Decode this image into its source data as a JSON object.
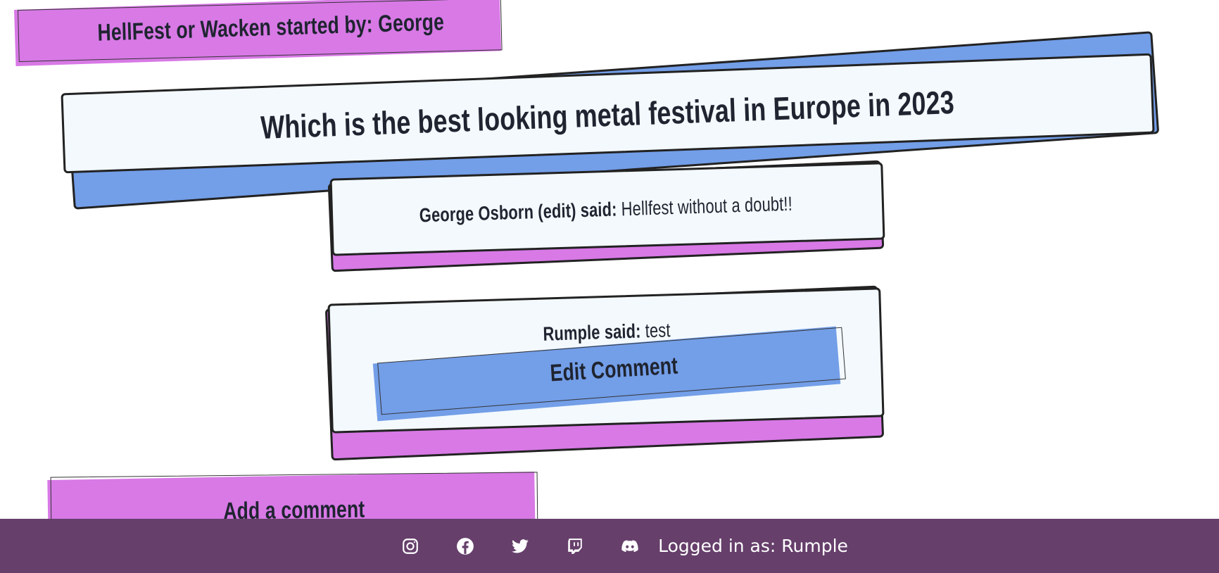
{
  "thread": {
    "started_by_label": "HellFest or Wacken started by: George",
    "title": "Which is the best looking metal festival in Europe in 2023"
  },
  "comments": [
    {
      "author": "George Osborn (edit) said:",
      "body": "Hellfest without a doubt!!"
    },
    {
      "author": "Rumple said:",
      "body": "test",
      "edit_label": "Edit Comment"
    }
  ],
  "add_comment_label": "Add a comment",
  "footer": {
    "icons": [
      "instagram-icon",
      "facebook-icon",
      "twitter-icon",
      "twitch-icon",
      "discord-icon"
    ],
    "login_status": "Logged in as: Rumple"
  },
  "colors": {
    "pink": "#d879e6",
    "blue": "#739ee8",
    "card": "#f3f9fd",
    "footer": "#663f6b"
  }
}
